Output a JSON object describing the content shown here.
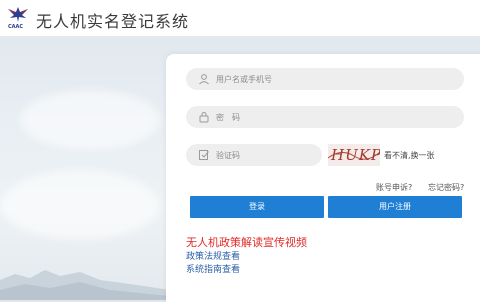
{
  "header": {
    "logo_text": "CAAC",
    "app_title": "无人机实名登记系统"
  },
  "login": {
    "username_placeholder": "用户名或手机号",
    "password_placeholder": "密　码",
    "captcha_placeholder": "验证码",
    "captcha_text": "HUKP",
    "captcha_refresh": "看不清,换一张",
    "account_appeal": "账号申诉?",
    "forgot_password": "忘记密码?",
    "login_button": "登录",
    "register_button": "用户注册"
  },
  "links": {
    "policy_video": "无人机政策解读宣传视频",
    "regulations": "政策法规查看",
    "guide": "系统指南查看"
  },
  "colors": {
    "primary": "#1e7fd4",
    "alert": "#e22a2a",
    "link": "#2a5fa8",
    "logo": "#2d3d8f"
  },
  "icons": {
    "username": "user-icon",
    "password": "lock-icon",
    "captcha": "checkbox-edit-icon"
  }
}
